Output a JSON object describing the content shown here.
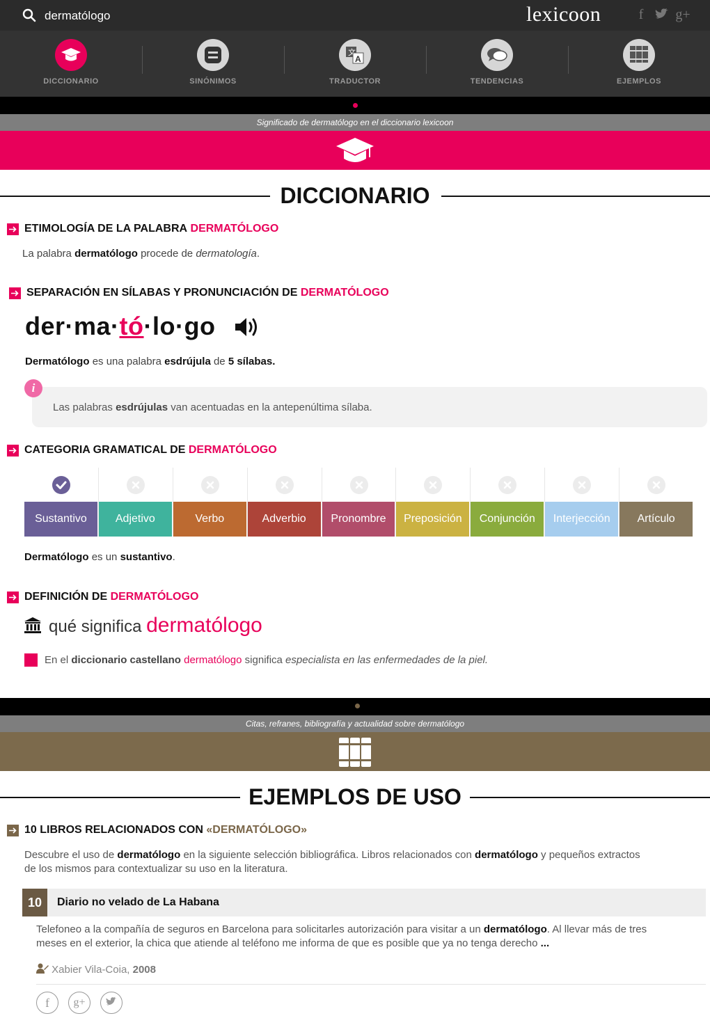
{
  "search": {
    "value": "dermatólogo"
  },
  "logo": "lexicoon",
  "social_top": [
    "f",
    "🐦",
    "g+"
  ],
  "nav": [
    {
      "label": "DICCIONARIO",
      "icon": "graduation-cap-icon",
      "active": true
    },
    {
      "label": "SINÓNIMOS",
      "icon": "equals-icon",
      "active": false
    },
    {
      "label": "TRADUCTOR",
      "icon": "translate-icon",
      "active": false
    },
    {
      "label": "TENDENCIAS",
      "icon": "chat-bubbles-icon",
      "active": false
    },
    {
      "label": "EJEMPLOS",
      "icon": "books-icon",
      "active": false
    }
  ],
  "dict_banner": "Significado de dermatólogo en el diccionario lexicoon",
  "dict_title": "DICCIONARIO",
  "etymology": {
    "heading": "ETIMOLOGÍA DE LA PALABRA",
    "word": "DERMATÓLOGO",
    "text_1": "La palabra",
    "word_bold": "dermatólogo",
    "text_2": "procede de",
    "source": "dermatología",
    "end": "."
  },
  "syllables": {
    "heading": "SEPARACIÓN EN SÍLABAS Y PRONUNCIACIÓN DE",
    "word": "DERMATÓLOGO",
    "before": "der·ma·",
    "stressed": "tó",
    "after": "·lo·go",
    "sentence_word": "Dermatólogo",
    "sentence_1": "es una palabra",
    "type": "esdrújula",
    "sentence_2": "de",
    "count": "5 sílabas.",
    "info_1": "Las palabras",
    "info_bold": "esdrújulas",
    "info_2": "van acentuadas en la antepenúltima sílaba."
  },
  "grammar": {
    "heading": "CATEGORIA GRAMATICAL DE",
    "word": "DERMATÓLOGO",
    "categories": [
      {
        "label": "Sustantivo",
        "color": "#6a5f97",
        "checked": true
      },
      {
        "label": "Adjetivo",
        "color": "#3fb39d",
        "checked": false
      },
      {
        "label": "Verbo",
        "color": "#bc6a31",
        "checked": false
      },
      {
        "label": "Adverbio",
        "color": "#ad4439",
        "checked": false
      },
      {
        "label": "Pronombre",
        "color": "#b14d6a",
        "checked": false
      },
      {
        "label": "Preposición",
        "color": "#cbb242",
        "checked": false
      },
      {
        "label": "Conjunción",
        "color": "#8aab3d",
        "checked": false
      },
      {
        "label": "Interjección",
        "color": "#a6cdee",
        "checked": false
      },
      {
        "label": "Artículo",
        "color": "#87785d",
        "checked": false
      }
    ],
    "sentence_word": "Dermatólogo",
    "sentence_1": "es un",
    "type": "sustantivo",
    "end": "."
  },
  "definition": {
    "heading": "DEFINICIÓN DE",
    "word": "DERMATÓLOGO",
    "que_significa": "qué significa",
    "word_lower": "dermatólogo",
    "line_1": "En el",
    "dict": "diccionario castellano",
    "word_link": "dermatólogo",
    "line_2": "significa",
    "meaning": "especialista en las enfermedades de la piel."
  },
  "examples_banner": "Citas, refranes, bibliografía y actualidad sobre dermatólogo",
  "examples_title": "EJEMPLOS DE USO",
  "books": {
    "heading": "10 LIBROS RELACIONADOS CON",
    "word": "«DERMATÓLOGO»",
    "intro_1": "Descubre el uso de",
    "intro_word": "dermatólogo",
    "intro_2": "en la siguiente selección bibliográfica. Libros relacionados con",
    "intro_word_2": "dermatólogo",
    "intro_3": "y pequeños extractos",
    "intro_4": "de los mismos para contextualizar su uso en la literatura.",
    "item": {
      "number": "10",
      "title": "Diario no velado de La Habana",
      "excerpt_1": "Telefoneo a la compañía de seguros en Barcelona para solicitarles autorización para visitar a un",
      "excerpt_word": "dermatólogo",
      "excerpt_2": ". Al llevar más de tres",
      "excerpt_3": "meses en el exterior, la chica que atiende al teléfono me informa de que es posible que ya no tenga derecho",
      "ellipsis": "...",
      "author": "Xabier Vila-Coia,",
      "year": "2008"
    }
  },
  "share": [
    "f",
    "g+",
    "🐦"
  ],
  "colors": {
    "pink": "#e8005a",
    "brown": "#7a6649",
    "dark": "#2b2b2b"
  }
}
